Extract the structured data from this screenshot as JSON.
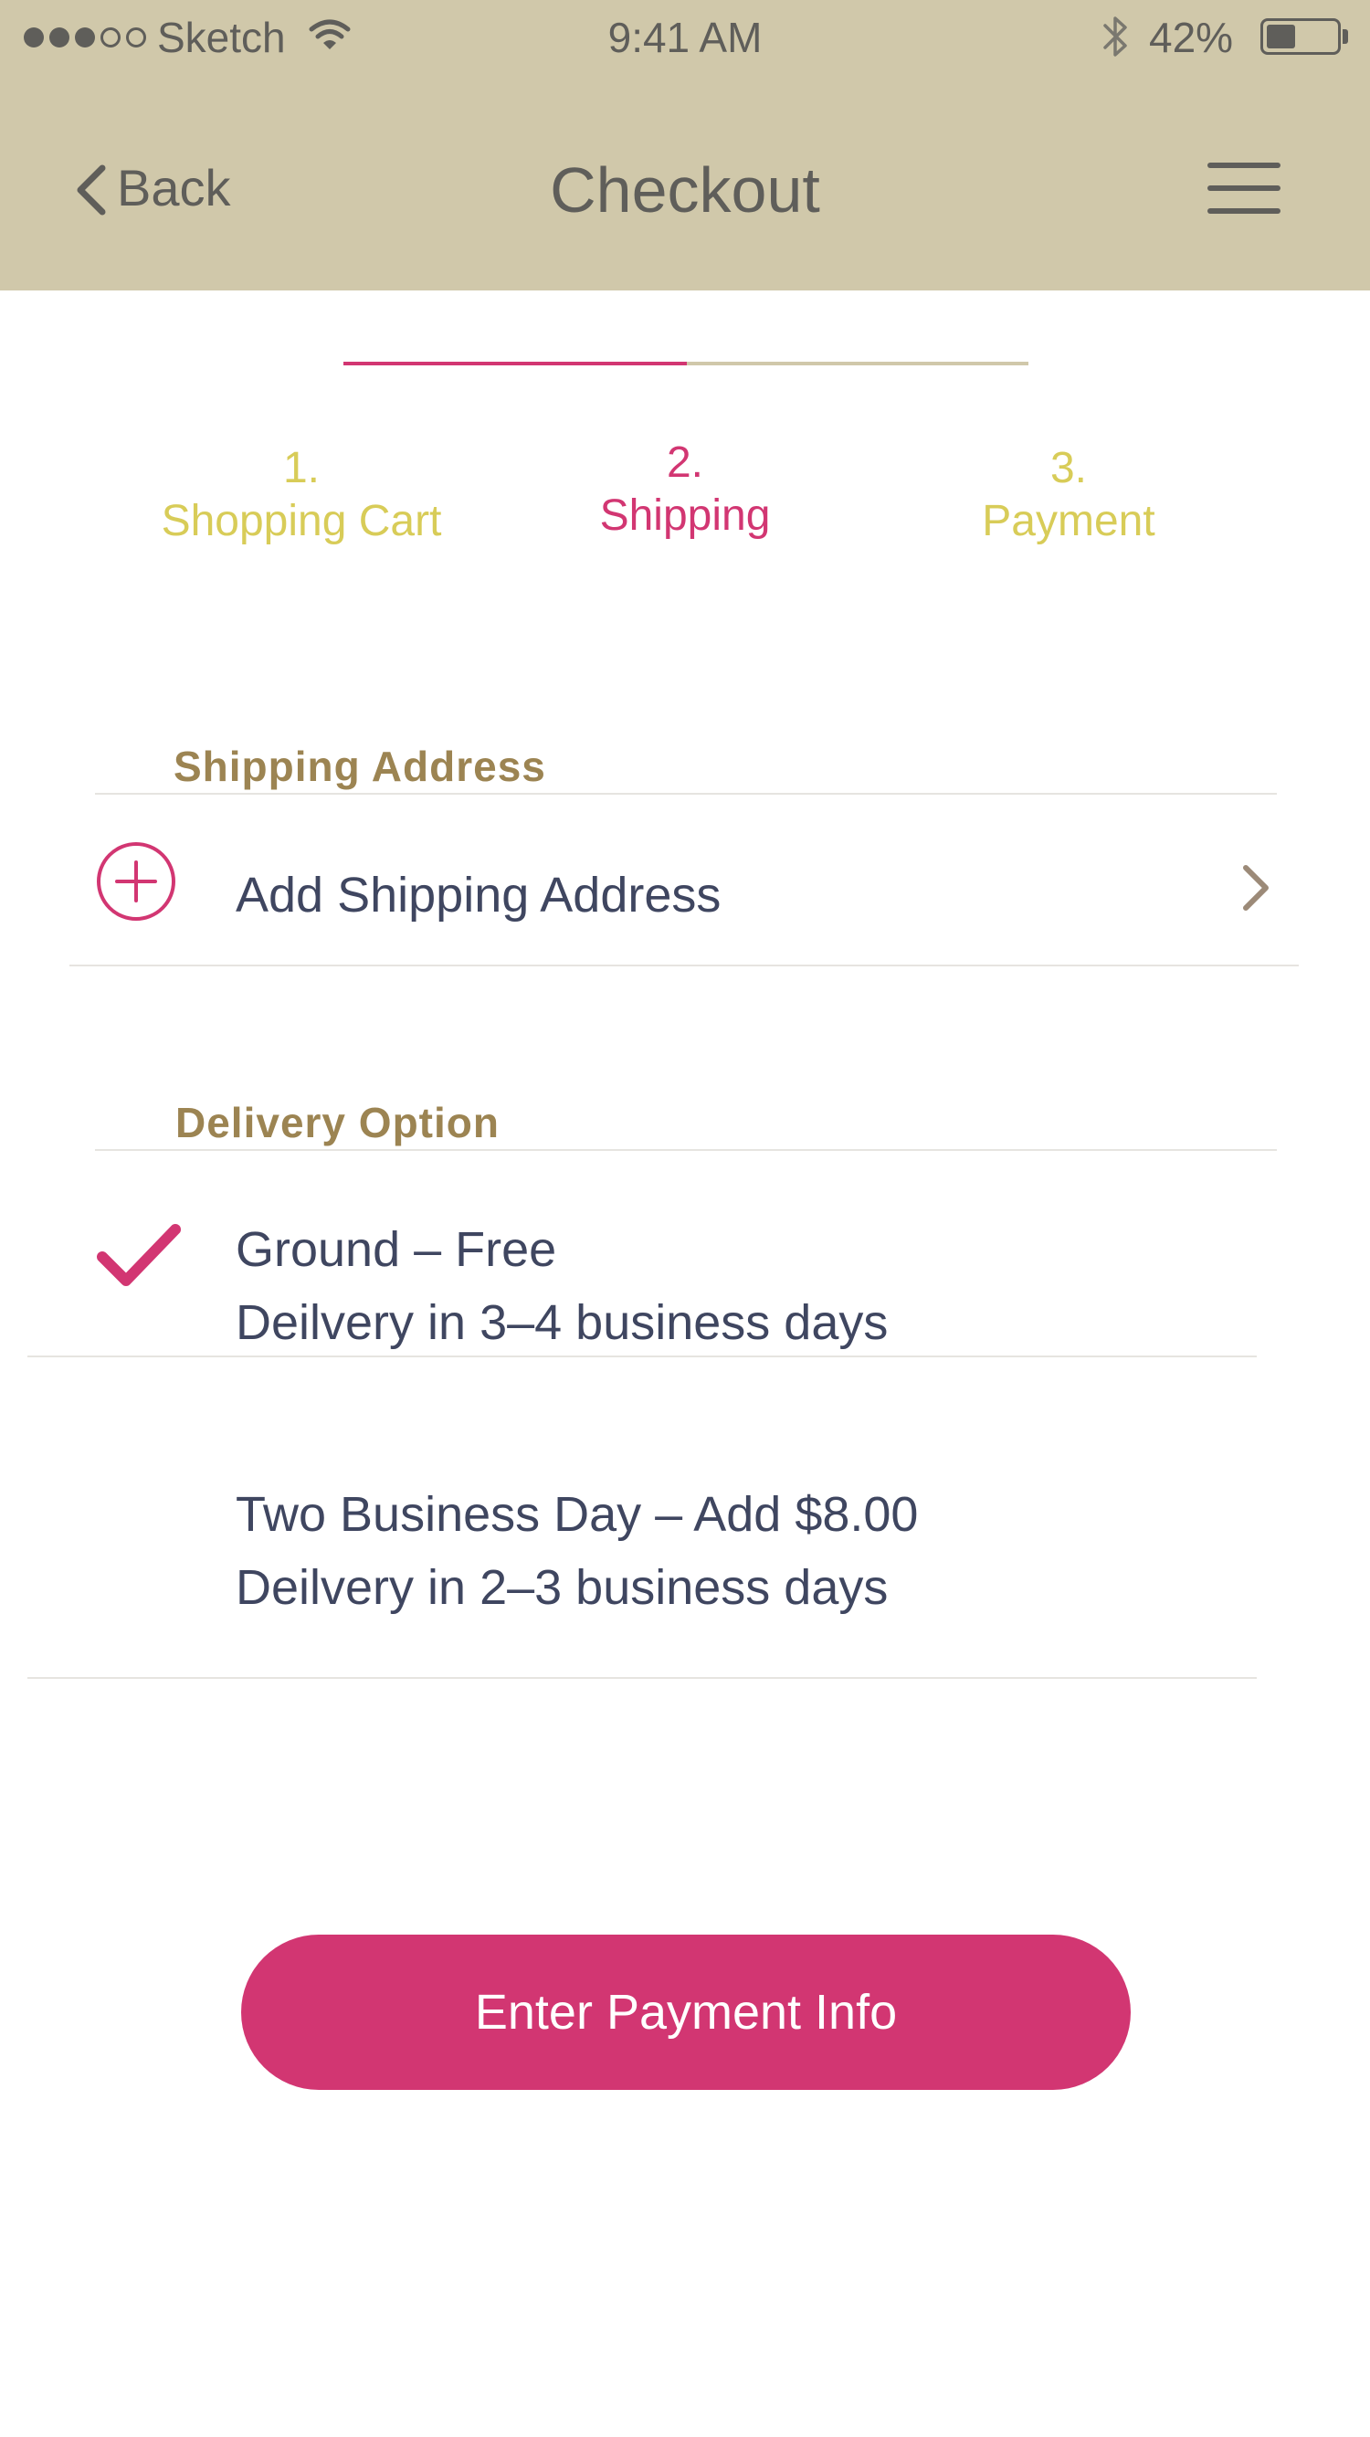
{
  "status_bar": {
    "carrier": "Sketch",
    "time": "9:41 AM",
    "battery_percent": "42%",
    "battery_level": 0.42
  },
  "nav": {
    "back_label": "Back",
    "title": "Checkout"
  },
  "steps": [
    {
      "number": "1.",
      "label": "Shopping Cart"
    },
    {
      "number": "2.",
      "label": "Shipping"
    },
    {
      "number": "3.",
      "label": "Payment"
    }
  ],
  "shipping_address": {
    "section_title": "Shipping Address",
    "add_label": "Add Shipping Address"
  },
  "delivery": {
    "section_title": "Delivery Option",
    "options": [
      {
        "title": "Ground – Free",
        "subtitle": "Deilvery in 3–4 business days",
        "selected": true
      },
      {
        "title": "Two Business Day – Add $8.00",
        "subtitle": "Deilvery in 2–3 business days",
        "selected": false
      }
    ]
  },
  "cta": {
    "label": "Enter Payment Info"
  },
  "colors": {
    "header_bg": "#D0C8AA",
    "accent": "#D23672",
    "step_inactive": "#D8CC58",
    "section_title": "#9C8452",
    "body_text": "#3f4660"
  }
}
